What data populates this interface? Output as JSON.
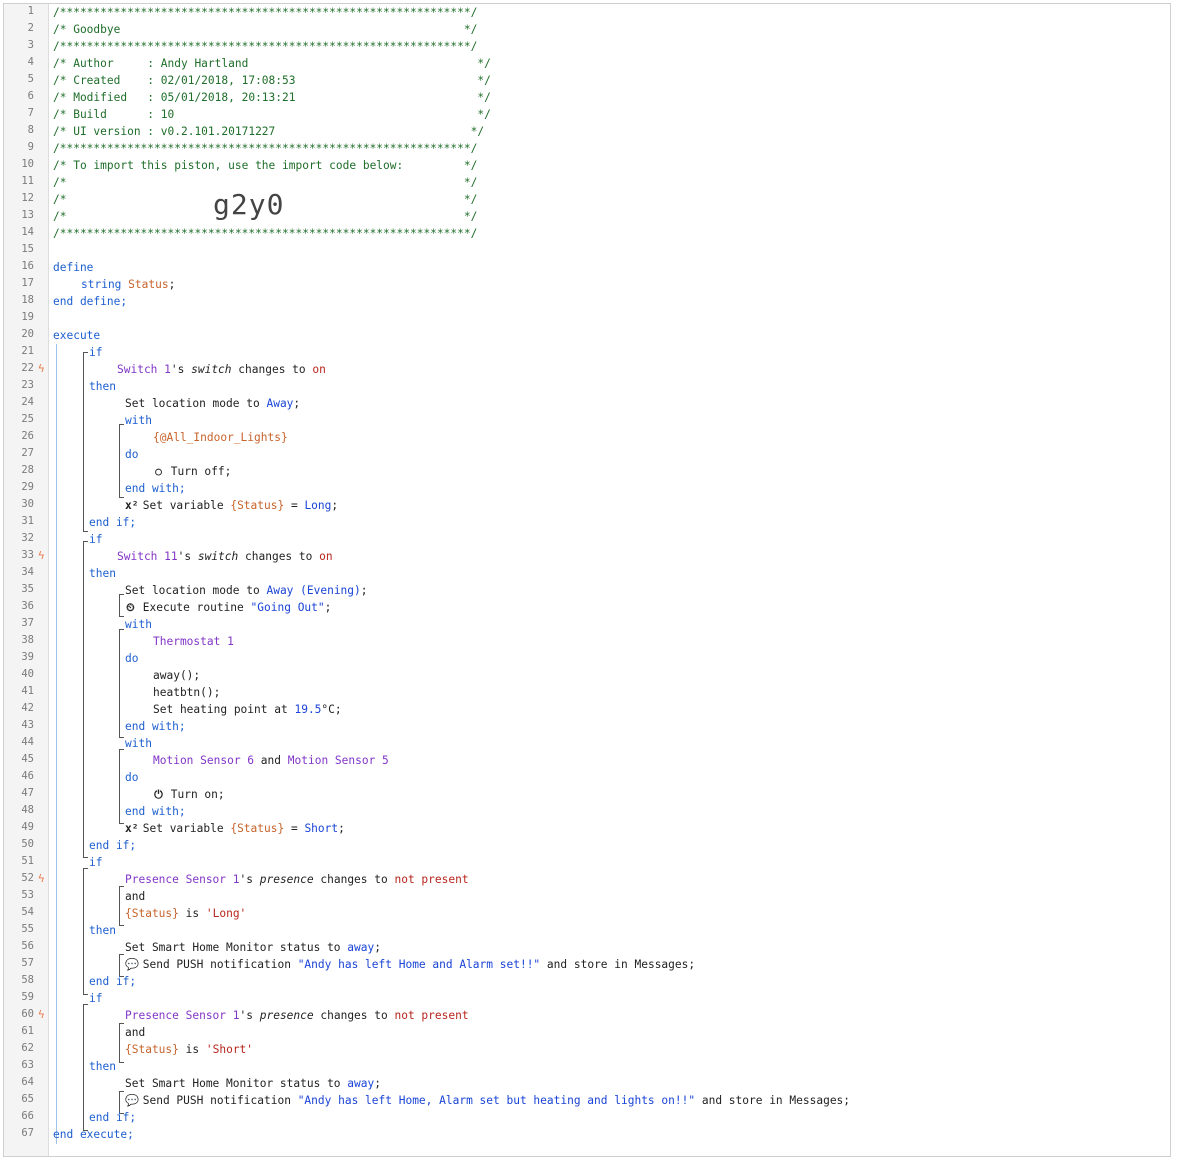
{
  "header": {
    "stars": "/*************************************************************/",
    "title": "/* Goodbye                                                   */",
    "author": "/* Author     : Andy Hartland                                  */",
    "created": "/* Created    : 02/01/2018, 17:08:53                           */",
    "modified": "/* Modified   : 05/01/2018, 20:13:21                           */",
    "build": "/* Build      : 10                                             */",
    "ui_version": "/* UI version : v0.2.101.20171227                             */",
    "import_hint": "/* To import this piston, use the import code below:         */",
    "blank": "/*                                                           */",
    "import_code": "g2y0"
  },
  "code": {
    "define": "define",
    "string_kw": "string",
    "status_var": "Status",
    "end_define": "end define;",
    "execute": "execute",
    "end_execute": "end execute;",
    "if": "if",
    "then": "then",
    "end_if": "end if;",
    "with": "with",
    "do": "do",
    "end_with": "end with;",
    "and": "and",
    "switch1": "Switch 1",
    "switch11": "Switch 11",
    "switch_attr": "switch",
    "changes_to": "changes to",
    "on": "on",
    "set_location": "Set location mode to",
    "away": "Away",
    "away_evening": "Away (Evening)",
    "all_indoor": "{@All_Indoor_Lights}",
    "turn_off": "Turn off;",
    "turn_on": "Turn on;",
    "set_variable": "Set variable",
    "status_ref": "{Status}",
    "long": "Long",
    "short": "Short",
    "execute_routine": "Execute routine",
    "going_out": "\"Going Out\"",
    "thermostat": "Thermostat 1",
    "away_fn": "away();",
    "heatbtn_fn": "heatbtn();",
    "set_heating": "Set heating point at",
    "heating_value": "19.5",
    "heating_unit": "°C;",
    "motion6": "Motion Sensor 6",
    "motion5": "Motion Sensor 5",
    "presence_sensor": "Presence Sensor 1",
    "presence_attr": "presence",
    "not_present": "not present",
    "is": "is",
    "long_q": "'Long'",
    "short_q": "'Short'",
    "set_shm": "Set Smart Home Monitor status to",
    "away_lc": "away",
    "send_push": "Send PUSH notification",
    "msg1": "\"Andy has left Home and Alarm set!!\"",
    "msg2": "\"Andy has left Home, Alarm set but heating and lights on!!\"",
    "store": "and store in Messages;"
  },
  "line_count": 67,
  "trigger_lines": [
    22,
    33,
    52,
    60
  ],
  "colors": {
    "comment": "#1f6e2a",
    "keyword": "#1d5fd0",
    "device": "#8236c7",
    "variable": "#c7642c",
    "string": "#b8261e",
    "bolt": "#ea7a4a"
  }
}
